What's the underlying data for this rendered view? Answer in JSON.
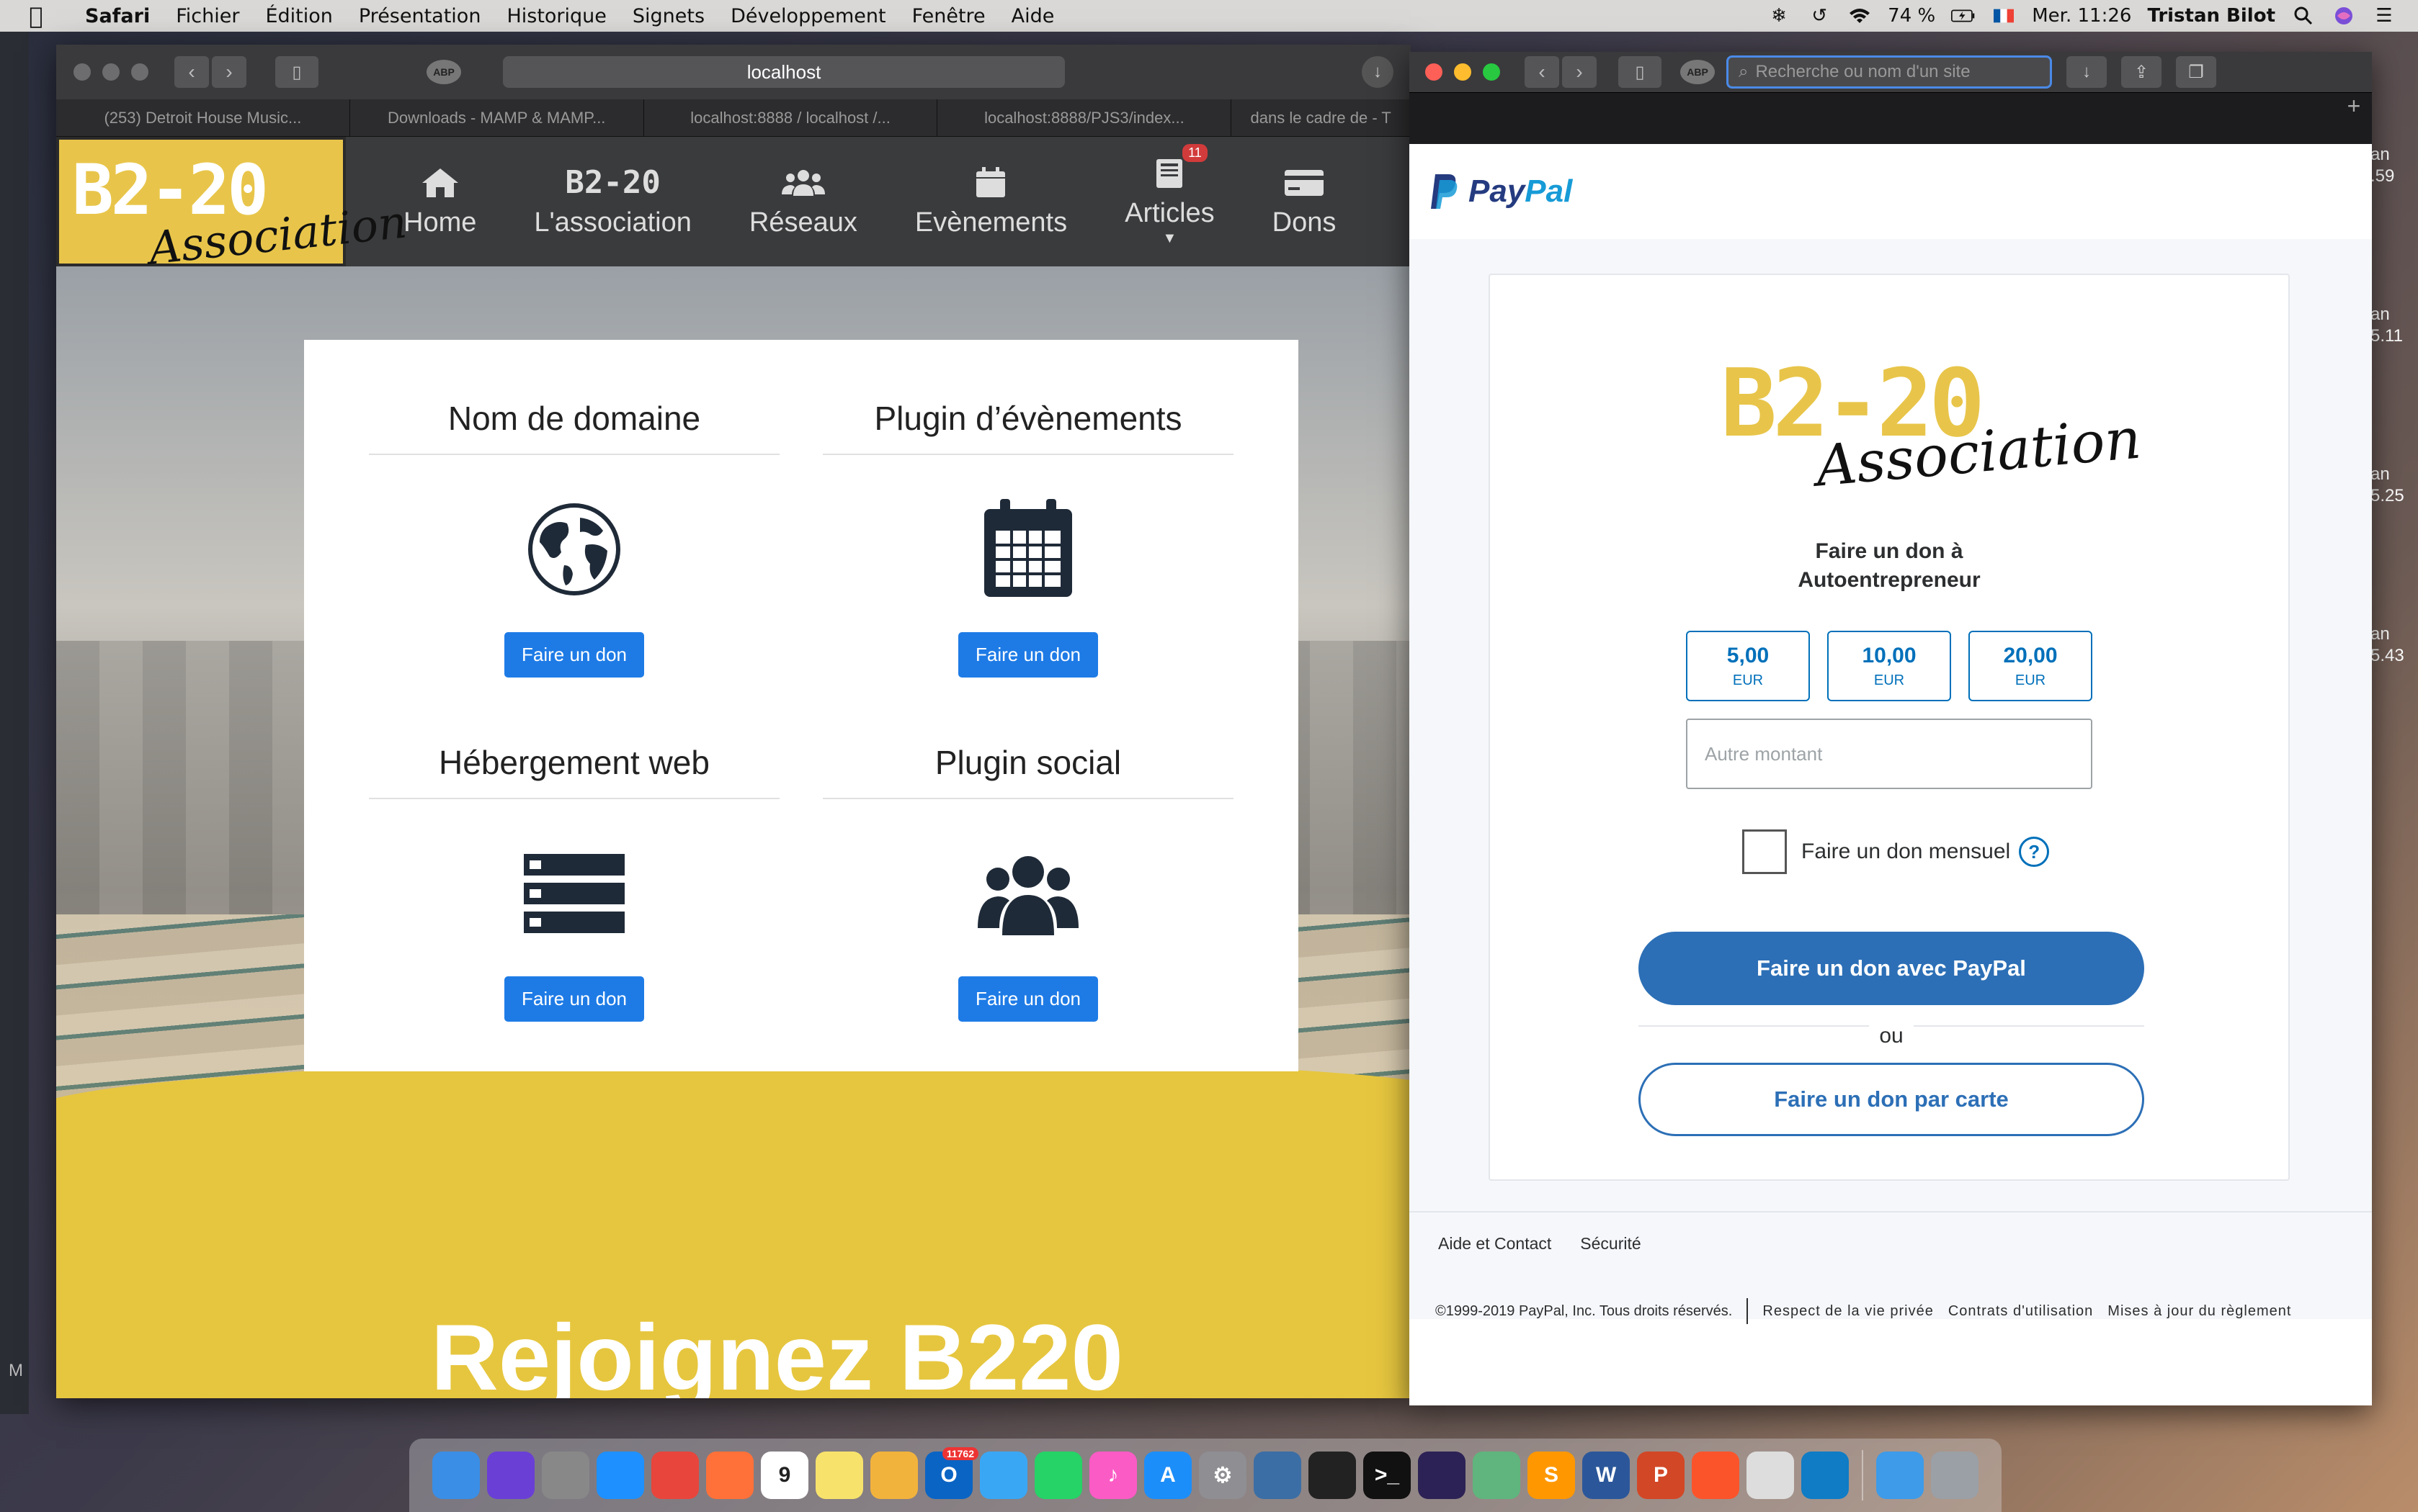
{
  "menubar": {
    "items": [
      "Safari",
      "Fichier",
      "Édition",
      "Présentation",
      "Historique",
      "Signets",
      "Développement",
      "Fenêtre",
      "Aide"
    ],
    "battery": "74 %",
    "datetime": "Mer. 11:26",
    "user": "Tristan Bilot"
  },
  "desktop": {
    "right_labels": [
      "an\n.59",
      "an\n5.11",
      "an\n5.25",
      "an\n5.43"
    ],
    "left_label": "M"
  },
  "left_window": {
    "url": "localhost",
    "tabs": [
      "(253) Detroit House Music...",
      "Downloads - MAMP & MAMP...",
      "localhost:8888 / localhost /...",
      "localhost:8888/PJS3/index...",
      "dans le cadre de - T"
    ],
    "site": {
      "logo_top": "B2-20",
      "logo_bottom": "Association",
      "nav": [
        {
          "label": "Home",
          "icon": "home-icon"
        },
        {
          "label": "L'association",
          "icon": "b220-mini-logo"
        },
        {
          "label": "Réseaux",
          "icon": "users-icon"
        },
        {
          "label": "Evènements",
          "icon": "calendar-icon"
        },
        {
          "label": "Articles",
          "icon": "newspaper-icon",
          "badge": "11"
        },
        {
          "label": "Dons",
          "icon": "credit-card-icon"
        }
      ],
      "mini_logo": "B2-20",
      "products": [
        {
          "title": "Nom de domaine",
          "icon": "globe-icon",
          "button": "Faire un don"
        },
        {
          "title": "Plugin d’évènements",
          "icon": "calendar-icon",
          "button": "Faire un don"
        },
        {
          "title": "Hébergement web",
          "icon": "server-icon",
          "button": "Faire un don"
        },
        {
          "title": "Plugin social",
          "icon": "users-icon",
          "button": "Faire un don"
        }
      ],
      "join_title": "Rejoignez B220"
    }
  },
  "right_window": {
    "search_placeholder": "Recherche ou nom d'un site",
    "paypal": {
      "brand_word1": "Pay",
      "brand_word2": "Pal",
      "logo_top": "B2-20",
      "logo_bottom": "Association",
      "description_line1": "Faire un don à",
      "description_line2": "Autoentrepreneur",
      "amounts": [
        {
          "value": "5,00",
          "currency": "EUR"
        },
        {
          "value": "10,00",
          "currency": "EUR"
        },
        {
          "value": "20,00",
          "currency": "EUR"
        }
      ],
      "other_placeholder": "Autre montant",
      "monthly_label": "Faire un don mensuel",
      "help_symbol": "?",
      "paypal_button": "Faire un don avec PayPal",
      "or_label": "ou",
      "card_button": "Faire un don par carte",
      "footer_links": [
        "Aide et Contact",
        "Sécurité"
      ],
      "copyright": "©1999-2019 PayPal, Inc. Tous droits réservés.",
      "legal_links": [
        "Respect de la vie privée",
        "Contrats d'utilisation",
        "Mises à jour du règlement"
      ]
    }
  },
  "dock": {
    "apps": [
      {
        "name": "finder",
        "label": "",
        "color": "#3a8ee6"
      },
      {
        "name": "siri",
        "label": "",
        "color": "#6a3fd6"
      },
      {
        "name": "launchpad",
        "label": "",
        "color": "#888888"
      },
      {
        "name": "safari",
        "label": "",
        "color": "#1e90ff"
      },
      {
        "name": "chrome",
        "label": "",
        "color": "#e8453c"
      },
      {
        "name": "firefox",
        "label": "",
        "color": "#ff7139"
      },
      {
        "name": "calendar",
        "label": "9",
        "color": "#ffffff"
      },
      {
        "name": "notes",
        "label": "",
        "color": "#f7e36b"
      },
      {
        "name": "photos",
        "label": "",
        "color": "#f2b33d"
      },
      {
        "name": "outlook",
        "label": "O",
        "color": "#0a64c4",
        "badge": "11762"
      },
      {
        "name": "messages",
        "label": "",
        "color": "#3aa7f5"
      },
      {
        "name": "whatsapp",
        "label": "",
        "color": "#25d366"
      },
      {
        "name": "itunes",
        "label": "♪",
        "color": "#fb5bc5"
      },
      {
        "name": "app-store",
        "label": "A",
        "color": "#1c8ef9"
      },
      {
        "name": "system-preferences",
        "label": "⚙",
        "color": "#8e8e93"
      },
      {
        "name": "xcode-tool",
        "label": "",
        "color": "#3b6ea5"
      },
      {
        "name": "activity-monitor",
        "label": "",
        "color": "#222222"
      },
      {
        "name": "terminal",
        "label": ">_",
        "color": "#111111"
      },
      {
        "name": "eclipse",
        "label": "",
        "color": "#2c2255"
      },
      {
        "name": "atom",
        "label": "",
        "color": "#5fb57d"
      },
      {
        "name": "sublime-text",
        "label": "S",
        "color": "#ff9800"
      },
      {
        "name": "word",
        "label": "W",
        "color": "#2b579a"
      },
      {
        "name": "powerpoint",
        "label": "P",
        "color": "#d24726"
      },
      {
        "name": "brave",
        "label": "",
        "color": "#fb542b"
      },
      {
        "name": "sequel-pro",
        "label": "",
        "color": "#dddddd"
      },
      {
        "name": "edge",
        "label": "",
        "color": "#0f7cc5"
      },
      {
        "name": "downloads-folder",
        "label": "",
        "color": "#3d9be9"
      },
      {
        "name": "trash",
        "label": "",
        "color": "#9aa0a6"
      }
    ]
  }
}
